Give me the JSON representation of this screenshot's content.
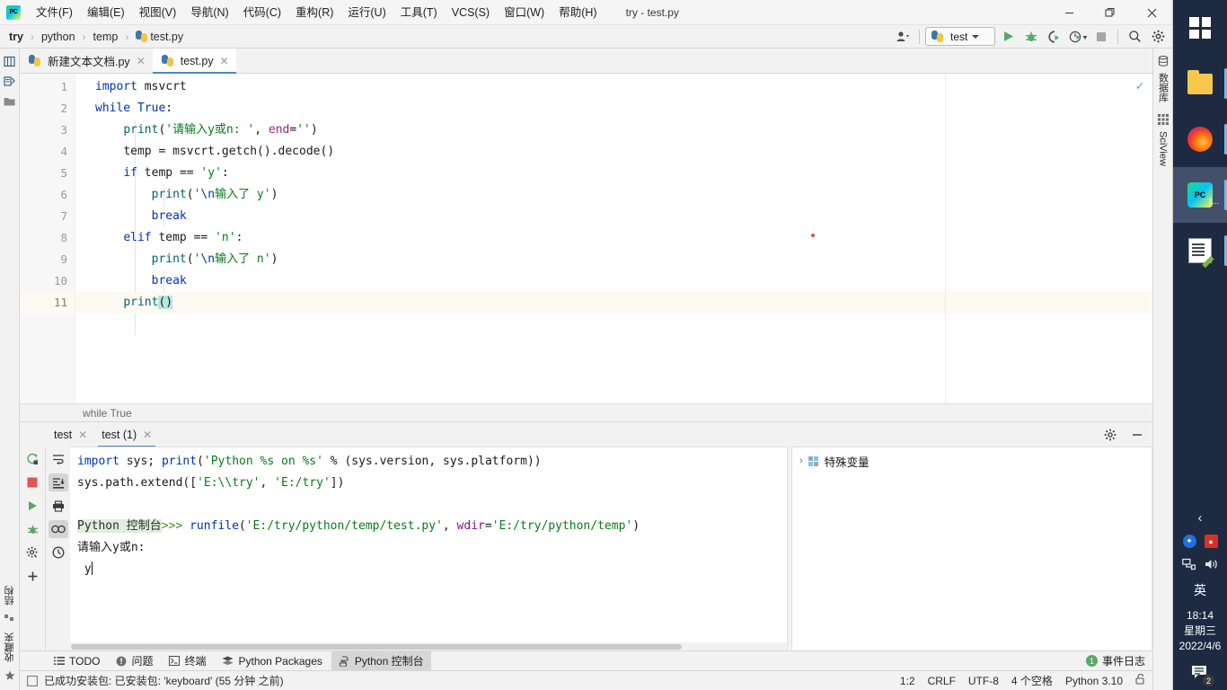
{
  "titlebar": {
    "app_icon": "pycharm-icon",
    "window_title": "try - test.py",
    "menus": [
      {
        "label": "文件(F)"
      },
      {
        "label": "编辑(E)"
      },
      {
        "label": "视图(V)"
      },
      {
        "label": "导航(N)"
      },
      {
        "label": "代码(C)"
      },
      {
        "label": "重构(R)"
      },
      {
        "label": "运行(U)"
      },
      {
        "label": "工具(T)"
      },
      {
        "label": "VCS(S)"
      },
      {
        "label": "窗口(W)"
      },
      {
        "label": "帮助(H)"
      }
    ],
    "controls": {
      "minimize": "—",
      "maximize": "❐",
      "close": "✕"
    }
  },
  "navbar": {
    "breadcrumbs": [
      "try",
      "python",
      "temp",
      "test.py"
    ],
    "separator": "›",
    "run_config": "test",
    "buttons": [
      "profile-icon",
      "run-icon",
      "debug-icon",
      "coverage-icon",
      "profiler-icon",
      "stop-icon",
      "search-icon",
      "settings-icon"
    ]
  },
  "left_stripe": {
    "top_items": [
      "project-icon",
      "commit-icon",
      "structure-icon"
    ],
    "bottom_items": [
      "结构",
      "收藏夹"
    ]
  },
  "right_stripe": {
    "items": [
      "数据库",
      "SciView"
    ]
  },
  "editor": {
    "tabs": [
      {
        "label": "新建文本文档.py",
        "active": false,
        "close": "✕"
      },
      {
        "label": "test.py",
        "active": true,
        "close": "✕"
      }
    ],
    "line_numbers": [
      "1",
      "2",
      "3",
      "4",
      "5",
      "6",
      "7",
      "8",
      "9",
      "10",
      "11"
    ],
    "current_line": 11,
    "lines": [
      "import msvcrt",
      "while True:",
      "    print('请输入y或n: ', end='')",
      "    temp = msvcrt.getch().decode()",
      "    if temp == 'y':",
      "        print('\\n输入了 y')",
      "        break",
      "    elif temp == 'n':",
      "        print('\\n输入了 n')",
      "        break",
      "    print()"
    ],
    "bottom_breadcrumb": "while True",
    "inspection_status": "✓"
  },
  "console": {
    "tabs": [
      {
        "label": "test",
        "active": false,
        "close": "✕"
      },
      {
        "label": "test (1)",
        "active": true,
        "close": "✕"
      }
    ],
    "toolbar_icons": [
      "rerun-icon",
      "stop-icon",
      "execute-icon",
      "debug-icon",
      "settings-icon",
      "add-icon",
      "soft-wrap-icon",
      "scroll-to-end-icon",
      "print-icon",
      "history-icon",
      "clock-icon"
    ],
    "panel_icons": [
      "gear-icon",
      "minimize-icon"
    ],
    "output": [
      {
        "text": "import sys; print('Python %s on %s' % (sys.version, sys.platform))"
      },
      {
        "text": "sys.path.extend(['E:\\\\try', 'E:/try'])"
      },
      {
        "text": ""
      },
      {
        "prompt": "Python 控制台",
        "gt": ">>> ",
        "text": "runfile('E:/try/python/temp/test.py', wdir='E:/try/python/temp')"
      },
      {
        "text": "请输入y或n:"
      },
      {
        "text": " y"
      }
    ],
    "variables": {
      "chevron": "›",
      "label": "特殊变量"
    }
  },
  "toolwindow_bar": {
    "items": [
      {
        "label": "TODO",
        "icon": "todo-icon",
        "active": false
      },
      {
        "label": "问题",
        "icon": "problems-icon",
        "active": false
      },
      {
        "label": "终端",
        "icon": "terminal-icon",
        "active": false
      },
      {
        "label": "Python Packages",
        "icon": "packages-icon",
        "active": false
      },
      {
        "label": "Python 控制台",
        "icon": "python-console-icon",
        "active": true
      }
    ],
    "event_log": {
      "count": "1",
      "label": "事件日志"
    }
  },
  "statusbar": {
    "message": "已成功安装包: 已安装包: 'keyboard' (55 分钟 之前)",
    "caret": "1:2",
    "line_sep": "CRLF",
    "encoding": "UTF-8",
    "indent": "4 个空格",
    "interpreter": "Python 3.10",
    "lock_icon": "unlocked-icon"
  },
  "taskbar": {
    "apps": [
      {
        "name": "start-button",
        "icon": "windows-logo-icon",
        "label": ""
      },
      {
        "name": "file-explorer",
        "icon": "folder-icon",
        "label": ""
      },
      {
        "name": "firefox",
        "icon": "firefox-icon",
        "label": ""
      },
      {
        "name": "pycharm",
        "icon": "pycharm-icon",
        "label": "t..."
      },
      {
        "name": "notepad-plus",
        "icon": "editor-icon",
        "label": ""
      }
    ],
    "tray": {
      "chevron": "‹",
      "bluetooth": "bluetooth-icon",
      "security": "security-icon",
      "network": "network-icon",
      "volume": "volume-icon",
      "ime": "英",
      "time": "18:14",
      "weekday": "星期三",
      "date": "2022/4/6",
      "notification_count": "2"
    }
  },
  "colors": {
    "accent": "#4a86c8",
    "keyword": "#0033b3",
    "string": "#067d17",
    "function": "#00627a",
    "param": "#9b2393",
    "green": "#59a869",
    "red": "#d9544a",
    "taskbar_bg": "#1d2a42"
  }
}
